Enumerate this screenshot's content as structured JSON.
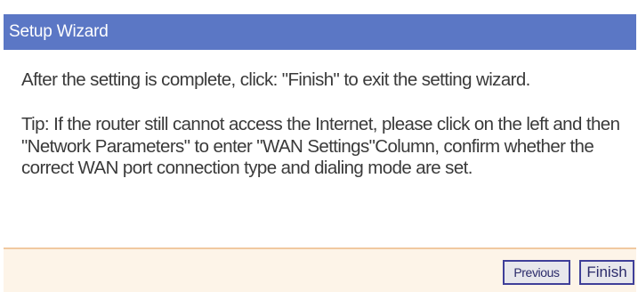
{
  "wizard": {
    "title": "Setup Wizard",
    "message": "After the setting is complete, click: \"Finish\" to exit the setting wizard.",
    "tip": "Tip: If the router still cannot access the Internet, please click on the left and then \"Network Parameters\" to enter \"WAN Settings\"Column, confirm whether the correct WAN port connection type and dialing mode are set.",
    "buttons": {
      "previous": "Previous",
      "finish": "Finish"
    }
  },
  "colors": {
    "title_bar": "#5b77c5",
    "footer": "#fdf4e8",
    "divider": "#f1c9a0",
    "button_border": "#3f3f99"
  }
}
